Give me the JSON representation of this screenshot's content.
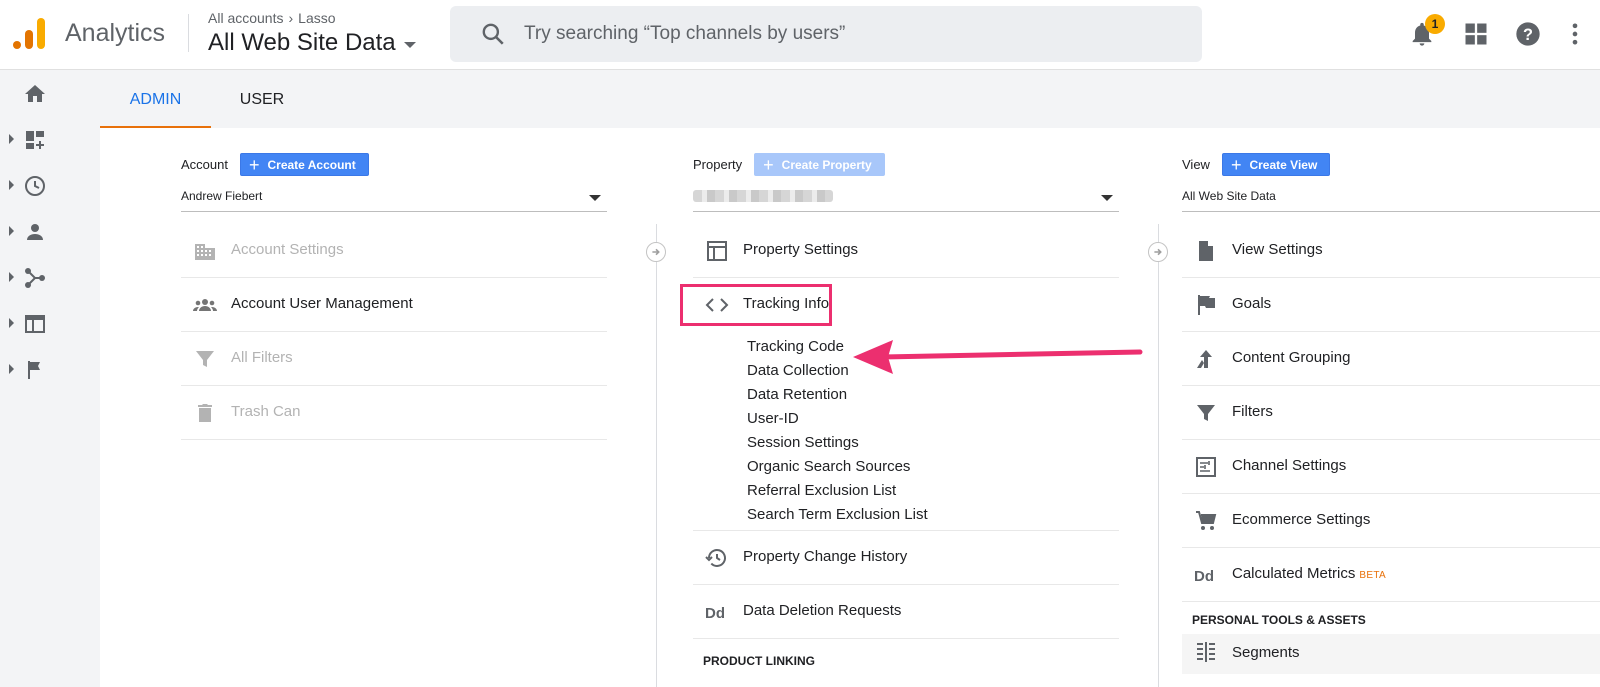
{
  "header": {
    "app_name": "Analytics",
    "breadcrumb": {
      "account": "All accounts",
      "property": "Lasso"
    },
    "view_name": "All Web Site Data",
    "search_placeholder": "Try searching “Top channels by users”",
    "notification_count": "1"
  },
  "tabs": [
    {
      "label": "ADMIN",
      "active": true
    },
    {
      "label": "USER",
      "active": false
    }
  ],
  "rail": [
    {
      "icon": "home-icon"
    },
    {
      "icon": "customization-icon"
    },
    {
      "icon": "realtime-clock-icon"
    },
    {
      "icon": "audience-person-icon"
    },
    {
      "icon": "acquisition-icon"
    },
    {
      "icon": "behavior-icon"
    },
    {
      "icon": "conversions-flag-icon"
    }
  ],
  "account": {
    "label": "Account",
    "create_label": "Create Account",
    "selected": "Andrew Fiebert",
    "items": [
      {
        "label": "Account Settings",
        "icon": "building-icon",
        "enabled": false
      },
      {
        "label": "Account User Management",
        "icon": "people-icon",
        "enabled": true
      },
      {
        "label": "All Filters",
        "icon": "filter-icon",
        "enabled": false
      },
      {
        "label": "Trash Can",
        "icon": "trash-icon",
        "enabled": false
      }
    ]
  },
  "property": {
    "label": "Property",
    "create_label": "Create Property",
    "items": [
      {
        "label": "Property Settings",
        "icon": "layout-icon"
      },
      {
        "label": "Tracking Info",
        "icon": "code-icon"
      }
    ],
    "tracking_subitems": [
      "Tracking Code",
      "Data Collection",
      "Data Retention",
      "User-ID",
      "Session Settings",
      "Organic Search Sources",
      "Referral Exclusion List",
      "Search Term Exclusion List"
    ],
    "more_items": [
      {
        "label": "Property Change History",
        "icon": "history-icon"
      },
      {
        "label": "Data Deletion Requests",
        "icon": "dd-icon"
      }
    ],
    "section": "PRODUCT LINKING"
  },
  "view": {
    "label": "View",
    "create_label": "Create View",
    "selected": "All Web Site Data",
    "items": [
      {
        "label": "View Settings",
        "icon": "document-icon"
      },
      {
        "label": "Goals",
        "icon": "flag-icon"
      },
      {
        "label": "Content Grouping",
        "icon": "content-grouping-icon"
      },
      {
        "label": "Filters",
        "icon": "filter-icon"
      },
      {
        "label": "Channel Settings",
        "icon": "channel-settings-icon"
      },
      {
        "label": "Ecommerce Settings",
        "icon": "cart-icon"
      },
      {
        "label": "Calculated Metrics",
        "icon": "dd-icon",
        "badge": "BETA"
      }
    ],
    "section": "PERSONAL TOOLS & ASSETS",
    "segments_label": "Segments"
  },
  "colors": {
    "accent": "#1a73e8",
    "orange": "#e8710a",
    "highlight": "#ec2f6f",
    "button": "#4285f4"
  }
}
